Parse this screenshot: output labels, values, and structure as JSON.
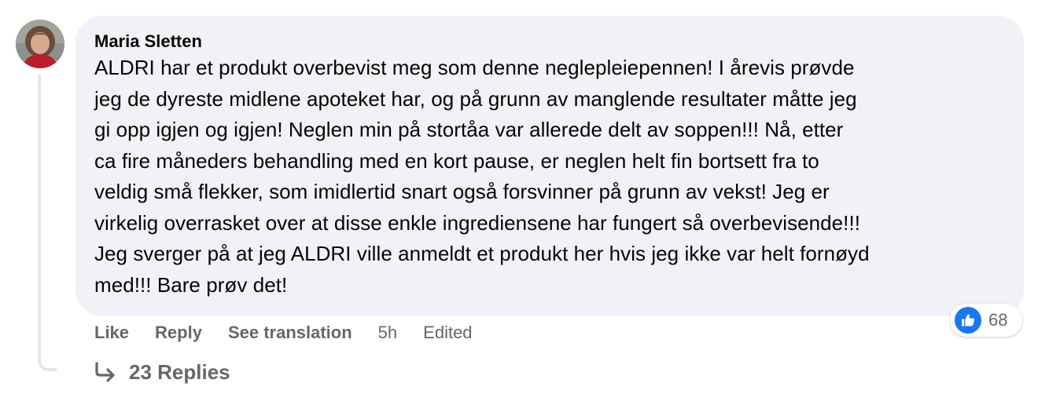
{
  "comment": {
    "author": "Maria Sletten",
    "text": "ALDRI har et produkt overbevist meg som denne neglepleiepennen! I årevis prøvde\njeg de dyreste midlene apoteket har, og på grunn av manglende resultater måtte jeg\ngi opp igjen og igjen! Neglen min på stortåa var allerede delt av soppen!!! Nå, etter\nca fire måneders behandling med en kort pause, er neglen helt fin bortsett fra to\nveldig små flekker, som imidlertid snart også forsvinner på grunn av vekst! Jeg er\nvirkelig overrasket over at disse enkle ingrediensene har fungert så overbevisende!!!\nJeg sverger på at jeg ALDRI ville anmeldt et produkt her hvis jeg ikke var helt fornøyd\nmed!!! Bare prøv det!",
    "timestamp": "5h",
    "edited_label": "Edited"
  },
  "actions": {
    "like": "Like",
    "reply": "Reply",
    "see_translation": "See translation"
  },
  "reactions": {
    "icon": "thumbs-up-icon",
    "count": "68",
    "color": "#1877f2"
  },
  "replies": {
    "icon": "reply-arrow-icon",
    "label": "23 Replies"
  },
  "colors": {
    "bubble": "#f0f2f5",
    "secondary_text": "#65676b",
    "thread_line": "#e4e6eb"
  }
}
